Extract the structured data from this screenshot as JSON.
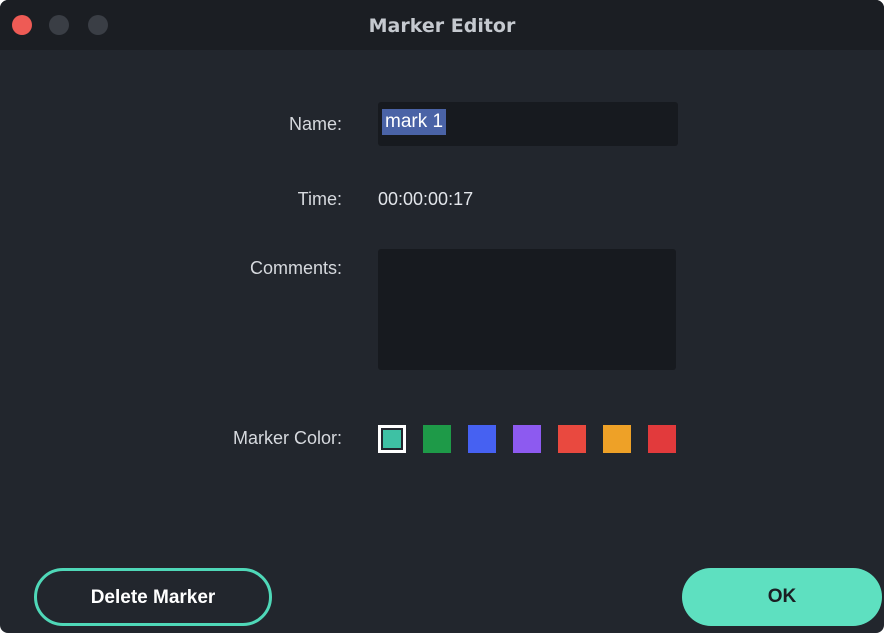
{
  "window": {
    "title": "Marker Editor"
  },
  "form": {
    "name_label": "Name:",
    "name_value": "mark 1",
    "time_label": "Time:",
    "time_value": "00:00:00:17",
    "comments_label": "Comments:",
    "comments_value": "",
    "color_label": "Marker Color:"
  },
  "colors": [
    {
      "name": "teal",
      "hex": "#3ec1a4",
      "selected": true
    },
    {
      "name": "green",
      "hex": "#1e9a48",
      "selected": false
    },
    {
      "name": "blue",
      "hex": "#4661f2",
      "selected": false
    },
    {
      "name": "purple",
      "hex": "#8d5af0",
      "selected": false
    },
    {
      "name": "red-orange",
      "hex": "#e9493f",
      "selected": false
    },
    {
      "name": "orange",
      "hex": "#eea127",
      "selected": false
    },
    {
      "name": "red",
      "hex": "#e23a3c",
      "selected": false
    }
  ],
  "buttons": {
    "delete_label": "Delete Marker",
    "ok_label": "OK"
  }
}
